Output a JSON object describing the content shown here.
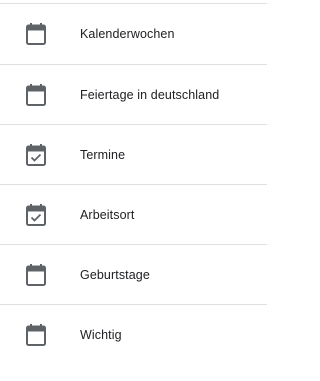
{
  "calendars": [
    {
      "label": "Kalenderwochen",
      "icon": "calendar-icon"
    },
    {
      "label": "Feiertage in deutschland",
      "icon": "calendar-icon"
    },
    {
      "label": "Termine",
      "icon": "calendar-check-icon"
    },
    {
      "label": "Arbeitsort",
      "icon": "calendar-check-icon"
    },
    {
      "label": "Geburtstage",
      "icon": "calendar-icon"
    },
    {
      "label": "Wichtig",
      "icon": "calendar-icon"
    }
  ],
  "colors": {
    "icon": "#5f6368",
    "divider": "#e0e0e0",
    "text": "#202124"
  }
}
